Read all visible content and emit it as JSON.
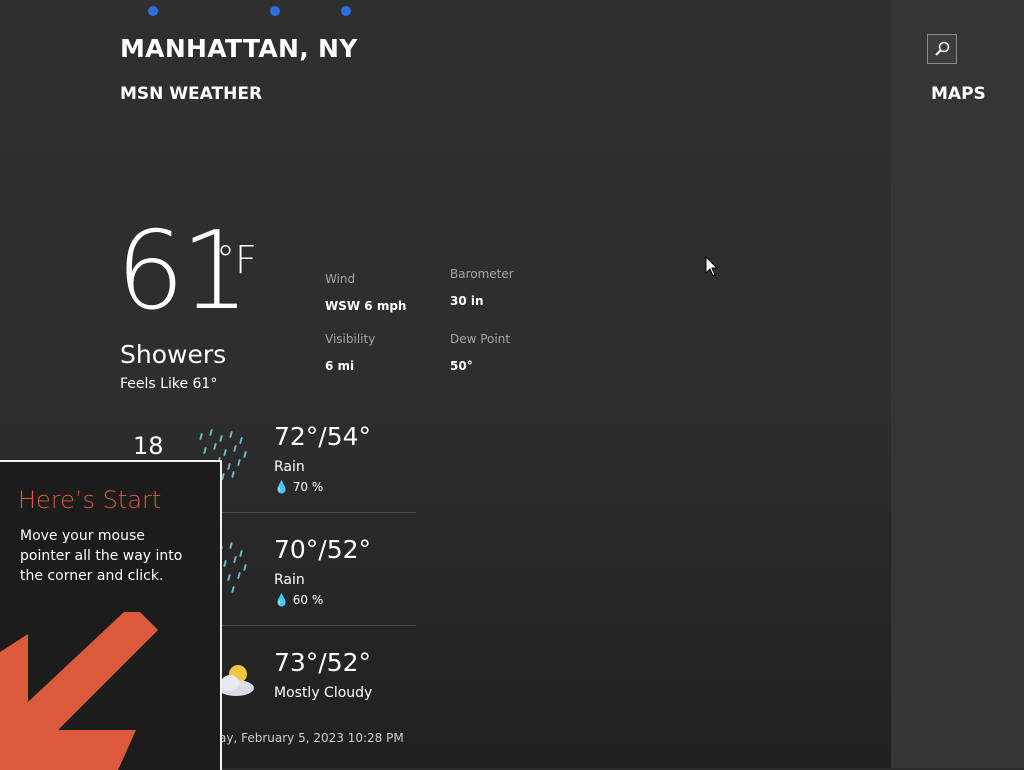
{
  "header": {
    "city": "MANHATTAN, NY",
    "app_name": "MSN WEATHER",
    "maps_label": "MAPS",
    "search_icon": "search-icon",
    "page_dot_color": "#2d6fd9"
  },
  "current": {
    "temperature": "61",
    "unit": "°F",
    "condition": "Showers",
    "feels_like": "Feels Like 61°",
    "wind_label": "Wind",
    "wind_value": "WSW 6 mph",
    "barometer_label": "Barometer",
    "barometer_value": "30 in",
    "visibility_label": "Visibility",
    "visibility_value": "6 mi",
    "dew_point_label": "Dew Point",
    "dew_point_value": "50°"
  },
  "forecast": [
    {
      "day": "18",
      "temps": "72°/54°",
      "condition": "Rain",
      "precip": "70 %",
      "icon": "rain-icon"
    },
    {
      "temps": "70°/52°",
      "condition": "Rain",
      "precip": "60 %",
      "icon": "rain-icon"
    },
    {
      "temps": "73°/52°",
      "condition": "Mostly Cloudy",
      "icon": "partly-cloudy-icon"
    }
  ],
  "updated": "ay, February 5, 2023 10:28 PM",
  "start_tip": {
    "title": "Here’s Start",
    "body": "Move your mouse pointer all the way into the corner and click.",
    "accent_color": "#dc5a3c",
    "arrow_icon": "arrow-down-left-icon"
  }
}
